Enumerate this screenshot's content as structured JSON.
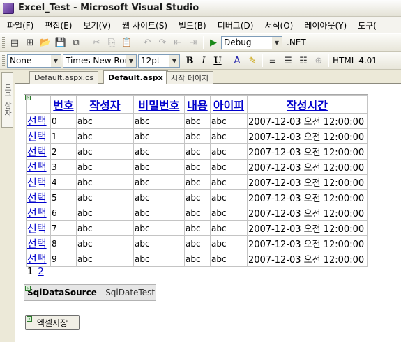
{
  "window": {
    "title": "Excel_Test - Microsoft Visual Studio"
  },
  "menu": [
    "파일(F)",
    "편집(E)",
    "보기(V)",
    "웹 사이트(S)",
    "빌드(B)",
    "디버그(D)",
    "서식(O)",
    "레이아웃(Y)",
    "도구("
  ],
  "toolbar1": {
    "config": "Debug",
    "platform": ".NET"
  },
  "toolbar2": {
    "style": "None",
    "font": "Times New Ror",
    "size": "12pt",
    "bold": "B",
    "italic": "I",
    "underline": "U",
    "doctype": "HTML 4.01"
  },
  "side_panel": {
    "label": "도구 상자"
  },
  "tabs": [
    "Default.aspx.cs",
    "Default.aspx",
    "시작 페이지"
  ],
  "grid": {
    "headers": [
      "번호",
      "작성자",
      "비밀번호",
      "내용",
      "아이피",
      "작성시간"
    ],
    "select_label": "선택",
    "rows": [
      {
        "id": "0",
        "writer": "abc",
        "password": "abc",
        "content": "abc",
        "ip": "abc",
        "created": "2007-12-03 오전 12:00:00"
      },
      {
        "id": "1",
        "writer": "abc",
        "password": "abc",
        "content": "abc",
        "ip": "abc",
        "created": "2007-12-03 오전 12:00:00"
      },
      {
        "id": "2",
        "writer": "abc",
        "password": "abc",
        "content": "abc",
        "ip": "abc",
        "created": "2007-12-03 오전 12:00:00"
      },
      {
        "id": "3",
        "writer": "abc",
        "password": "abc",
        "content": "abc",
        "ip": "abc",
        "created": "2007-12-03 오전 12:00:00"
      },
      {
        "id": "4",
        "writer": "abc",
        "password": "abc",
        "content": "abc",
        "ip": "abc",
        "created": "2007-12-03 오전 12:00:00"
      },
      {
        "id": "5",
        "writer": "abc",
        "password": "abc",
        "content": "abc",
        "ip": "abc",
        "created": "2007-12-03 오전 12:00:00"
      },
      {
        "id": "6",
        "writer": "abc",
        "password": "abc",
        "content": "abc",
        "ip": "abc",
        "created": "2007-12-03 오전 12:00:00"
      },
      {
        "id": "7",
        "writer": "abc",
        "password": "abc",
        "content": "abc",
        "ip": "abc",
        "created": "2007-12-03 오전 12:00:00"
      },
      {
        "id": "8",
        "writer": "abc",
        "password": "abc",
        "content": "abc",
        "ip": "abc",
        "created": "2007-12-03 오전 12:00:00"
      },
      {
        "id": "9",
        "writer": "abc",
        "password": "abc",
        "content": "abc",
        "ip": "abc",
        "created": "2007-12-03 오전 12:00:00"
      }
    ],
    "pager": {
      "current": "1",
      "next": "2"
    }
  },
  "datasource": {
    "name": "SqlDataSource",
    "separator": "-",
    "id": "SqlDateTest"
  },
  "excel_button": {
    "label": "엑셀저장"
  },
  "colors": {
    "link": "#0000cc",
    "chrome": "#ece9d8"
  }
}
